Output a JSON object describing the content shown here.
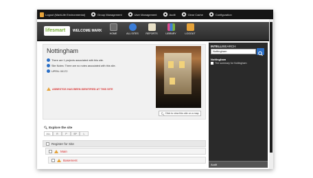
{
  "topbar": {
    "items": [
      {
        "label": "Logout (MarkLife Environmental)",
        "icon": "lock-icon"
      },
      {
        "label": "Group Management",
        "icon": "gear-icon"
      },
      {
        "label": "User Management",
        "icon": "gear-icon"
      },
      {
        "label": "Audit",
        "icon": "gear-icon"
      },
      {
        "label": "Clear Cache",
        "icon": "gear-icon"
      },
      {
        "label": "Configuration",
        "icon": "gear-icon"
      }
    ]
  },
  "header": {
    "logo_a": "life",
    "logo_b": "smart",
    "welcome": "WELCOME MARK",
    "nav": [
      {
        "label": "HOME",
        "icon": "home-icon",
        "color": "#6b6b6b"
      },
      {
        "label": "ALL SITES",
        "icon": "globe-icon",
        "color": "#3b7dd8"
      },
      {
        "label": "REPORTS",
        "icon": "reports-icon",
        "color": "#e9e1c8"
      },
      {
        "label": "LIBRARY",
        "icon": "library-icon",
        "color": "#e04b8c"
      },
      {
        "label": "LOGOUT",
        "icon": "lock-icon",
        "color": "#e6a33a"
      }
    ]
  },
  "site": {
    "title": "Nottingham",
    "projects": "There are 1 projects associated with this site.",
    "notes": "Site Notes: There are no notes associated with this site.",
    "uprn": "UPRN: 00172",
    "asbestos_warning": "ASBESTOS HAS BEEN IDENTIFIED AT THIS SITE",
    "map_button": "Click to view this site on a map"
  },
  "explore": {
    "title": "Explore the site",
    "tabs": [
      "ALL",
      "R",
      "P",
      "SP",
      "L"
    ],
    "register_label": "Register for Site",
    "rows": [
      {
        "label": "Main"
      },
      {
        "label": "Basement"
      }
    ]
  },
  "sidebar": {
    "title_a": "INTELLI",
    "title_b": "SEARCH",
    "search_value": "Nottingham",
    "result_title": "Nottingham",
    "result_sub": "The summary for Nottingham",
    "audit": "Audit"
  }
}
